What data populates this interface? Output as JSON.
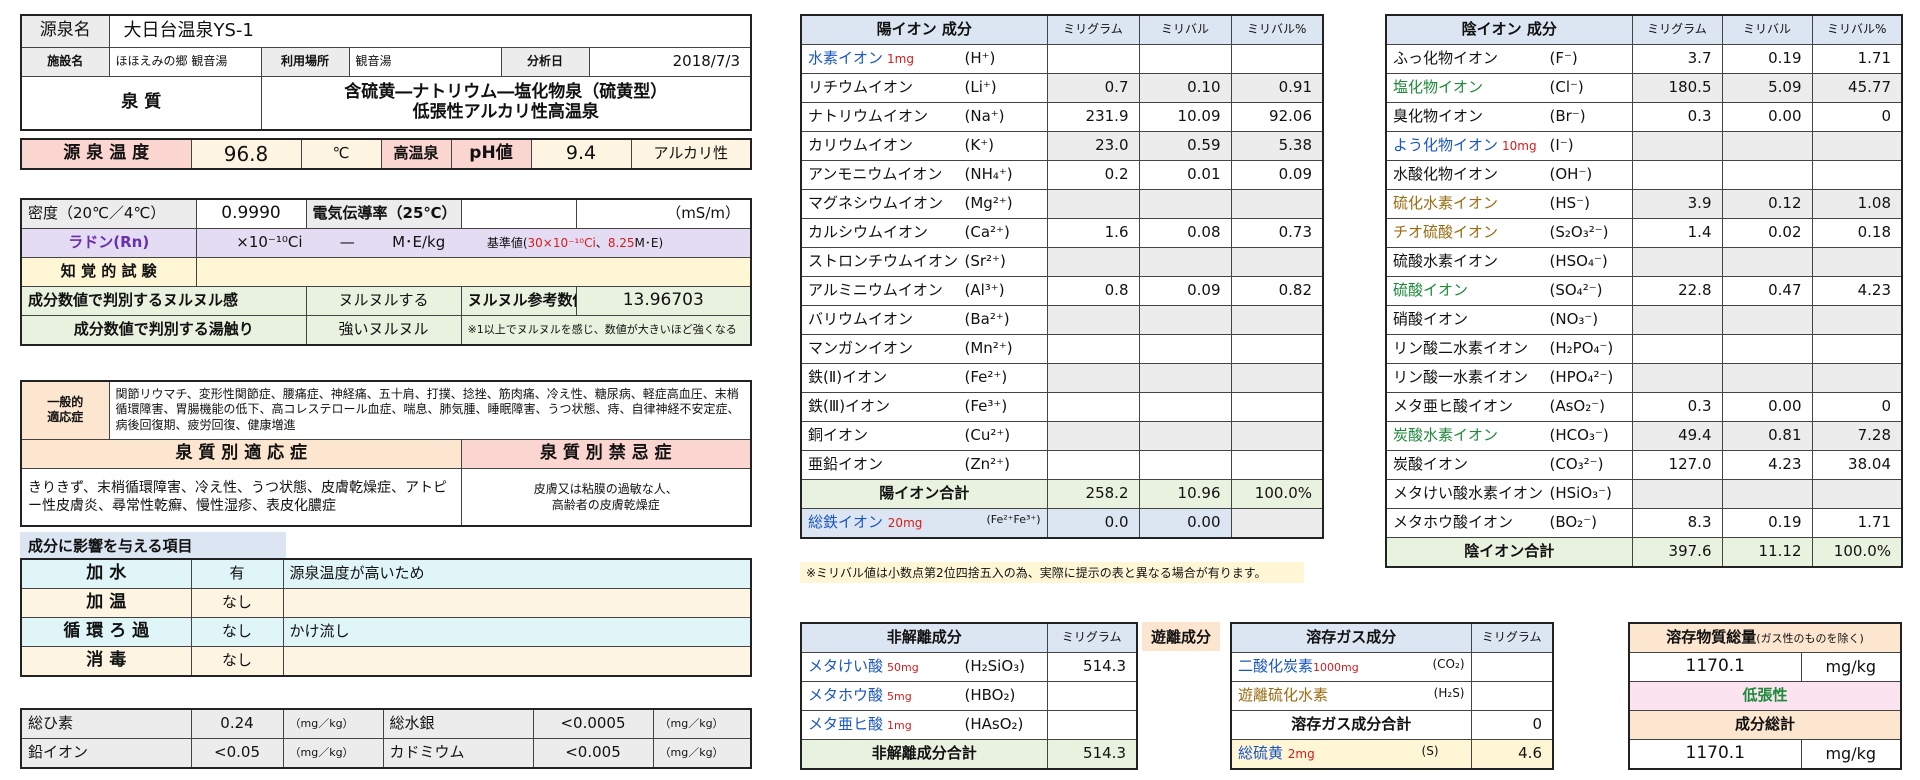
{
  "header": {
    "source_label": "源泉名",
    "source_name": "大日台温泉YS-1",
    "facility_label": "施設名",
    "facility": "ほほえみの郷 観音湯",
    "use_label": "利用場所",
    "use_place": "観音湯",
    "date_label": "分析日",
    "date": "2018/7/3",
    "quality_label": "泉 質",
    "quality_line1": "含硫黄―ナトリウム―塩化物泉（硫黄型）",
    "quality_line2": "低張性アルカリ性高温泉",
    "temp_label": "源 泉 温 度",
    "temp_value": "96.8",
    "temp_unit": "℃",
    "temp_class": "高温泉",
    "ph_label": "pH値",
    "ph_value": "9.4",
    "ph_class": "アルカリ性"
  },
  "physical": {
    "density_label": "密度（20℃／4℃）",
    "density_value": "0.9990",
    "conductivity_label": "電気伝導率（25℃）",
    "conductivity_unit": "（mS/m）",
    "radon_label": "ラドン(Rn)",
    "radon_ci": "×10⁻¹⁰Ci",
    "radon_dash": "—",
    "radon_unit": "M･E/kg",
    "radon_ref_a": "基準値(",
    "radon_ref_b": "30×10⁻¹⁰Ci",
    "radon_ref_c": "、",
    "radon_ref_d": "8.25",
    "radon_ref_e": "M･E)",
    "perception_label": "知 覚 的 試 験",
    "slippery_label": "成分数値で判別するヌルヌル感",
    "slippery_value": "ヌルヌルする",
    "slippery_ref_label": "ヌルヌル参考数値",
    "slippery_ref_value": "13.96703",
    "feel_label": "成分数値で判別する湯触り",
    "feel_value": "強いヌルヌル",
    "feel_note": "※1以上でヌルヌルを感じ、数値が大きいほど強くなる"
  },
  "indications": {
    "general_label_1": "一般的",
    "general_label_2": "適応症",
    "general_text": "関節リウマチ、変形性関節症、腰痛症、神経痛、五十肩、打撲、捻挫、筋肉痛、冷え性、糖尿病、軽症高血圧、末梢循環障害、胃腸機能の低下、高コレステロール血症、喘息、肺気腫、睡眠障害、うつ状態、痔、自律神経不安定症、病後回復期、疲労回復、健康増進",
    "specific_label": "泉 質 別 適 応 症",
    "specific_text": "きりきず、末梢循環障害、冷え性、うつ状態、皮膚乾燥症、アトピー性皮膚炎、尋常性乾癬、慢性湿疹、表皮化膿症",
    "contra_label": "泉 質 別 禁 忌 症",
    "contra_line1": "皮膚又は粘膜の過敏な人、",
    "contra_line2": "高齢者の皮膚乾燥症"
  },
  "influence": {
    "title": "成分に影響を与える項目",
    "rows": [
      {
        "label": "加 水",
        "value": "有",
        "note": "源泉温度が高いため"
      },
      {
        "label": "加 温",
        "value": "なし",
        "note": ""
      },
      {
        "label": "循 環 ろ 過",
        "value": "なし",
        "note": "かけ流し"
      },
      {
        "label": "消 毒",
        "value": "なし",
        "note": ""
      }
    ]
  },
  "metals": {
    "r1": {
      "a_label": "総ひ素",
      "a_value": "0.24",
      "a_unit": "（mg／kg）",
      "b_label": "総水銀",
      "b_value": "<0.0005",
      "b_unit": "（mg／kg）"
    },
    "r2": {
      "a_label": "鉛イオン",
      "a_value": "<0.05",
      "a_unit": "（mg／kg）",
      "b_label": "カドミウム",
      "b_value": "<0.005",
      "b_unit": "（mg／kg）"
    }
  },
  "cation": {
    "title": "陽イオン 成分",
    "h_mg": "ミリグラム",
    "h_mval": "ミリバル",
    "h_pct": "ミリバル%",
    "rows": [
      {
        "name": "水素イオン",
        "tag": "1mg",
        "formula": "(H⁺)",
        "mg": "",
        "mval": "",
        "pct": ""
      },
      {
        "name": "リチウムイオン",
        "tag": "",
        "formula": "(Li⁺)",
        "mg": "0.7",
        "mval": "0.10",
        "pct": "0.91"
      },
      {
        "name": "ナトリウムイオン",
        "tag": "",
        "formula": "(Na⁺)",
        "mg": "231.9",
        "mval": "10.09",
        "pct": "92.06"
      },
      {
        "name": "カリウムイオン",
        "tag": "",
        "formula": "(K⁺)",
        "mg": "23.0",
        "mval": "0.59",
        "pct": "5.38"
      },
      {
        "name": "アンモニウムイオン",
        "tag": "",
        "formula": "(NH₄⁺)",
        "mg": "0.2",
        "mval": "0.01",
        "pct": "0.09"
      },
      {
        "name": "マグネシウムイオン",
        "tag": "",
        "formula": "(Mg²⁺)",
        "mg": "",
        "mval": "",
        "pct": ""
      },
      {
        "name": "カルシウムイオン",
        "tag": "",
        "formula": "(Ca²⁺)",
        "mg": "1.6",
        "mval": "0.08",
        "pct": "0.73"
      },
      {
        "name": "ストロンチウムイオン",
        "tag": "",
        "formula": "(Sr²⁺)",
        "mg": "",
        "mval": "",
        "pct": ""
      },
      {
        "name": "アルミニウムイオン",
        "tag": "",
        "formula": "(Al³⁺)",
        "mg": "0.8",
        "mval": "0.09",
        "pct": "0.82"
      },
      {
        "name": "バリウムイオン",
        "tag": "",
        "formula": "(Ba²⁺)",
        "mg": "",
        "mval": "",
        "pct": ""
      },
      {
        "name": "マンガンイオン",
        "tag": "",
        "formula": "(Mn²⁺)",
        "mg": "",
        "mval": "",
        "pct": ""
      },
      {
        "name": "鉄(Ⅱ)イオン",
        "tag": "",
        "formula": "(Fe²⁺)",
        "mg": "",
        "mval": "",
        "pct": ""
      },
      {
        "name": "鉄(Ⅲ)イオン",
        "tag": "",
        "formula": "(Fe³⁺)",
        "mg": "",
        "mval": "",
        "pct": ""
      },
      {
        "name": "銅イオン",
        "tag": "",
        "formula": "(Cu²⁺)",
        "mg": "",
        "mval": "",
        "pct": ""
      },
      {
        "name": "亜鉛イオン",
        "tag": "",
        "formula": "(Zn²⁺)",
        "mg": "",
        "mval": "",
        "pct": ""
      }
    ],
    "total_label": "陽イオン合計",
    "total_mg": "258.2",
    "total_mval": "10.96",
    "total_pct": "100.0%",
    "iron_label": "総鉄イオン",
    "iron_tag": "20mg",
    "iron_formula": "(Fe²⁺Fe³⁺)",
    "iron_mg": "0.0",
    "iron_mval": "0.00",
    "note": "※ミリバル値は小数点第2位四捨五入の為、実際に提示の表と異なる場合が有ります。"
  },
  "anion": {
    "title": "陰イオン 成分",
    "h_mg": "ミリグラム",
    "h_mval": "ミリバル",
    "h_pct": "ミリバル%",
    "rows": [
      {
        "name": "ふっ化物イオン",
        "tag": "",
        "formula": "(F⁻)",
        "mg": "3.7",
        "mval": "0.19",
        "pct": "1.71",
        "color": ""
      },
      {
        "name": "塩化物イオン",
        "tag": "",
        "formula": "(Cl⁻)",
        "mg": "180.5",
        "mval": "5.09",
        "pct": "45.77",
        "color": "tgreen"
      },
      {
        "name": "臭化物イオン",
        "tag": "",
        "formula": "(Br⁻)",
        "mg": "0.3",
        "mval": "0.00",
        "pct": "0",
        "color": ""
      },
      {
        "name": "よう化物イオン",
        "tag": "10mg",
        "formula": "(I⁻)",
        "mg": "",
        "mval": "",
        "pct": "",
        "color": "tblue"
      },
      {
        "name": "水酸化物イオン",
        "tag": "",
        "formula": "(OH⁻)",
        "mg": "",
        "mval": "",
        "pct": "",
        "color": ""
      },
      {
        "name": "硫化水素イオン",
        "tag": "",
        "formula": "(HS⁻)",
        "mg": "3.9",
        "mval": "0.12",
        "pct": "1.08",
        "color": "tolive"
      },
      {
        "name": "チオ硫酸イオン",
        "tag": "",
        "formula": "(S₂O₃²⁻)",
        "mg": "1.4",
        "mval": "0.02",
        "pct": "0.18",
        "color": "tolive"
      },
      {
        "name": "硫酸水素イオン",
        "tag": "",
        "formula": "(HSO₄⁻)",
        "mg": "",
        "mval": "",
        "pct": "",
        "color": ""
      },
      {
        "name": "硫酸イオン",
        "tag": "",
        "formula": "(SO₄²⁻)",
        "mg": "22.8",
        "mval": "0.47",
        "pct": "4.23",
        "color": "tgreen"
      },
      {
        "name": "硝酸イオン",
        "tag": "",
        "formula": "(NO₃⁻)",
        "mg": "",
        "mval": "",
        "pct": "",
        "color": ""
      },
      {
        "name": "リン酸二水素イオン",
        "tag": "",
        "formula": "(H₂PO₄⁻)",
        "mg": "",
        "mval": "",
        "pct": "",
        "color": ""
      },
      {
        "name": "リン酸一水素イオン",
        "tag": "",
        "formula": "(HPO₄²⁻)",
        "mg": "",
        "mval": "",
        "pct": "",
        "color": ""
      },
      {
        "name": "メタ亜ヒ酸イオン",
        "tag": "",
        "formula": "(AsO₂⁻)",
        "mg": "0.3",
        "mval": "0.00",
        "pct": "0",
        "color": ""
      },
      {
        "name": "炭酸水素イオン",
        "tag": "",
        "formula": "(HCO₃⁻)",
        "mg": "49.4",
        "mval": "0.81",
        "pct": "7.28",
        "color": "tgreen"
      },
      {
        "name": "炭酸イオン",
        "tag": "",
        "formula": "(CO₃²⁻)",
        "mg": "127.0",
        "mval": "4.23",
        "pct": "38.04",
        "color": ""
      },
      {
        "name": "メタけい酸水素イオン",
        "tag": "",
        "formula": "(HSiO₃⁻)",
        "mg": "",
        "mval": "",
        "pct": "",
        "color": ""
      },
      {
        "name": "メタホウ酸イオン",
        "tag": "",
        "formula": "(BO₂⁻)",
        "mg": "8.3",
        "mval": "0.19",
        "pct": "1.71",
        "color": ""
      }
    ],
    "total_label": "陰イオン合計",
    "total_mg": "397.6",
    "total_mval": "11.12",
    "total_pct": "100.0%"
  },
  "nondiss": {
    "title": "非解離成分",
    "h_mg": "ミリグラム",
    "rows": [
      {
        "name": "メタけい酸",
        "tag": "50mg",
        "formula": "(H₂SiO₃)",
        "mg": "514.3"
      },
      {
        "name": "メタホウ酸",
        "tag": "5mg",
        "formula": "(HBO₂)",
        "mg": ""
      },
      {
        "name": "メタ亜ヒ酸",
        "tag": "1mg",
        "formula": "(HAsO₂)",
        "mg": ""
      }
    ],
    "total_label": "非解離成分合計",
    "total_mg": "514.3"
  },
  "free_label": "遊離成分",
  "gas": {
    "title": "溶存ガス成分",
    "h_mg": "ミリグラム",
    "r1_name": "二酸化炭素",
    "r1_tag": "1000mg",
    "r1_formula": "(CO₂)",
    "r1_mg": "",
    "r2_name": "遊離硫化水素",
    "r2_formula": "(H₂S)",
    "r2_mg": "",
    "total_label": "溶存ガス成分合計",
    "total_mg": "0",
    "s_name": "総硫黄",
    "s_tag": "2mg",
    "s_formula": "(S)",
    "s_mg": "4.6"
  },
  "summary": {
    "title": "溶存物質総量",
    "title_note": "(ガス性のものを除く)",
    "dissolved_value": "1170.1",
    "unit": "mg/kg",
    "tonicity": "低張性",
    "total_label": "成分総計",
    "total_value": "1170.1",
    "total_unit": "mg/kg"
  }
}
